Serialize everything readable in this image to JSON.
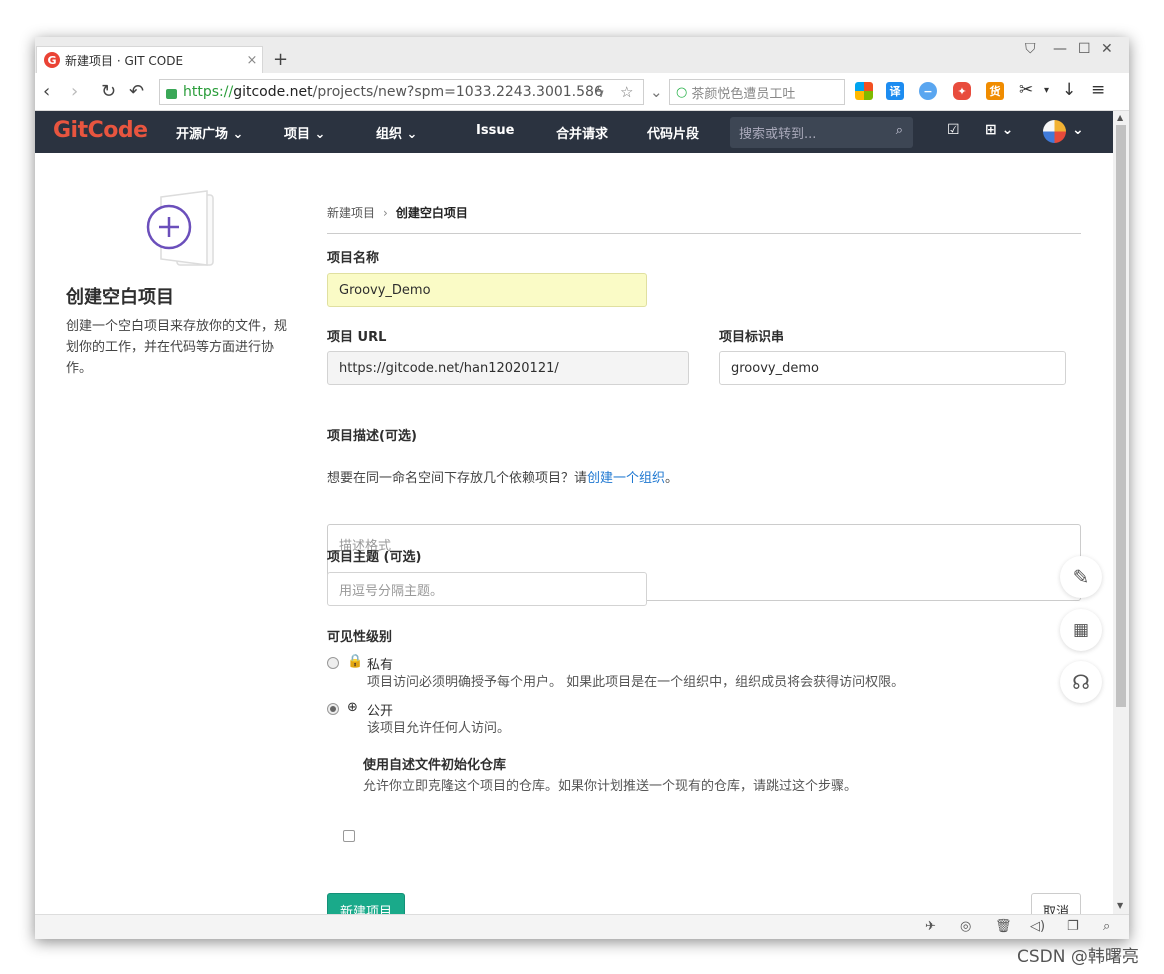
{
  "browser": {
    "tab_title": "新建项目 · GIT CODE",
    "tab_favicon": "G",
    "tab_close": "×",
    "new_tab": "+",
    "url_scheme": "https://",
    "url_host": "gitcode.net",
    "url_path": "/projects/new?spm=1033.2243.3001.586",
    "search_placeholder": "茶颜悦色遭员工吐",
    "ext_translate": "译",
    "ext_goods": "货"
  },
  "topnav": {
    "logo": "GitCode",
    "items": [
      "开源广场 ⌄",
      "项目 ⌄",
      "组织 ⌄",
      "Issue",
      "合并请求",
      "代码片段"
    ],
    "search_placeholder": "搜索或转到...",
    "plus_label": "⊞ ⌄",
    "todo_label": "☑",
    "avatar_caret": "⌄"
  },
  "sidebar": {
    "title": "创建空白项目",
    "description": "创建一个空白项目来存放你的文件，规划你的工作，并在代码等方面进行协作。"
  },
  "breadcrumb": {
    "parent": "新建项目",
    "separator": "›",
    "current": "创建空白项目"
  },
  "form": {
    "project_name_label": "项目名称",
    "project_name_value": "Groovy_Demo",
    "project_url_label": "项目 URL",
    "project_url_value": "https://gitcode.net/han12020121/",
    "project_slug_label": "项目标识串",
    "project_slug_value": "groovy_demo",
    "namespace_help_prefix": "想要在同一命名空间下存放几个依赖项目？请",
    "namespace_help_link": "创建一个组织",
    "namespace_help_suffix": "。",
    "description_label": "项目描述(可选)",
    "description_placeholder": "描述格式",
    "topics_label": "项目主题 (可选)",
    "topics_placeholder": "用逗号分隔主题。",
    "visibility_label": "可见性级别",
    "private_label": "私有",
    "private_desc": "项目访问必须明确授予每个用户。 如果此项目是在一个组织中，组织成员将会获得访问权限。",
    "public_label": "公开",
    "public_desc": "该项目允许任何人访问。",
    "selected_visibility": "公开",
    "readme_label": "使用自述文件初始化仓库",
    "readme_desc": "允许你立即克隆这个项目的仓库。如果你计划推送一个现有的仓库，请跳过这个步骤。",
    "readme_checked": false,
    "create_button": "新建项目",
    "cancel_button": "取消"
  },
  "watermark": "CSDN @韩曙亮",
  "colors": {
    "nav_bg": "#2b3340",
    "logo": "#e8553f",
    "primary_button": "#1aaa8a",
    "link": "#1f78d1",
    "highlight_input": "#fafbc6",
    "plus_circle": "#6b4fbb"
  },
  "icons": {
    "sidebar": "new-project-icon",
    "float": [
      "feedback-icon",
      "qrcode-icon",
      "support-icon"
    ]
  }
}
